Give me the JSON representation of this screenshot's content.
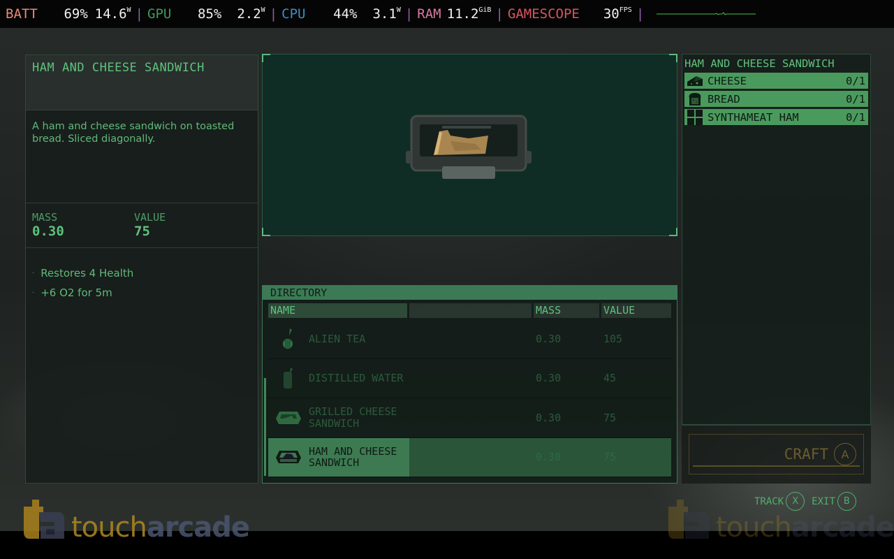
{
  "perf_overlay": {
    "batt": {
      "label": "BATT",
      "percent": "69%",
      "power": "14.6",
      "power_unit": "W"
    },
    "gpu": {
      "label": "GPU",
      "percent": "85%",
      "power": "2.2",
      "power_unit": "W"
    },
    "cpu": {
      "label": "CPU",
      "percent": "44%",
      "power": "3.1",
      "power_unit": "W"
    },
    "ram": {
      "label": "RAM",
      "amount": "11.2",
      "unit": "GiB"
    },
    "gamescope": {
      "label": "GAMESCOPE",
      "fps": "30",
      "fps_unit": "FPS"
    },
    "separator": "|"
  },
  "item_info": {
    "title": "HAM AND CHEESE SANDWICH",
    "description": "A ham and cheese sandwich on toasted bread. Sliced diagonally.",
    "mass_label": "MASS",
    "mass_value": "0.30",
    "value_label": "VALUE",
    "value_value": "75",
    "effects": [
      {
        "bullet": "·",
        "text": "Restores 4 Health"
      },
      {
        "bullet": "·",
        "text": "+6 O2 for 5m"
      }
    ]
  },
  "preview": {
    "model": "ham-and-cheese-sandwich-in-container"
  },
  "directory": {
    "header": "DIRECTORY",
    "columns": {
      "name": "NAME",
      "blank": "",
      "mass": "MASS",
      "value": "VALUE"
    },
    "rows": [
      {
        "name": "ALIEN TEA",
        "mass": "0.30",
        "value": "105",
        "icon": "alien-tea-icon",
        "selected": false
      },
      {
        "name": "DISTILLED WATER",
        "mass": "0.30",
        "value": "45",
        "icon": "bottle-icon",
        "selected": false
      },
      {
        "name": "GRILLED CHEESE SANDWICH",
        "mass": "0.30",
        "value": "75",
        "icon": "sandwich-container-icon",
        "selected": false
      },
      {
        "name": "HAM AND CHEESE SANDWICH",
        "mass": "0.30",
        "value": "75",
        "icon": "sandwich-container-icon",
        "selected": true
      }
    ],
    "scroll_position_fraction": 1.0
  },
  "recipe": {
    "title": "HAM AND CHEESE SANDWICH",
    "ingredients": [
      {
        "name": "CHEESE",
        "count": "0/1",
        "icon": "cheese-icon"
      },
      {
        "name": "BREAD",
        "count": "0/1",
        "icon": "bread-icon"
      },
      {
        "name": "SYNTHAMEAT HAM",
        "count": "0/1",
        "icon": "grid-squares-icon"
      }
    ]
  },
  "craft": {
    "label": "CRAFT",
    "button_glyph": "A"
  },
  "hints": [
    {
      "label": "TRACK",
      "button_glyph": "X"
    },
    {
      "label": "EXIT",
      "button_glyph": "B"
    }
  ],
  "watermark": {
    "touch": "touch",
    "arcade": "arcade"
  },
  "colors": {
    "ui_green": "#5fc27c",
    "selected_green": "#3d7a52",
    "ingredient_green": "#4a9a5e",
    "craft_disabled": "#6b5c2c",
    "preview_bg": "#0f2d24"
  }
}
